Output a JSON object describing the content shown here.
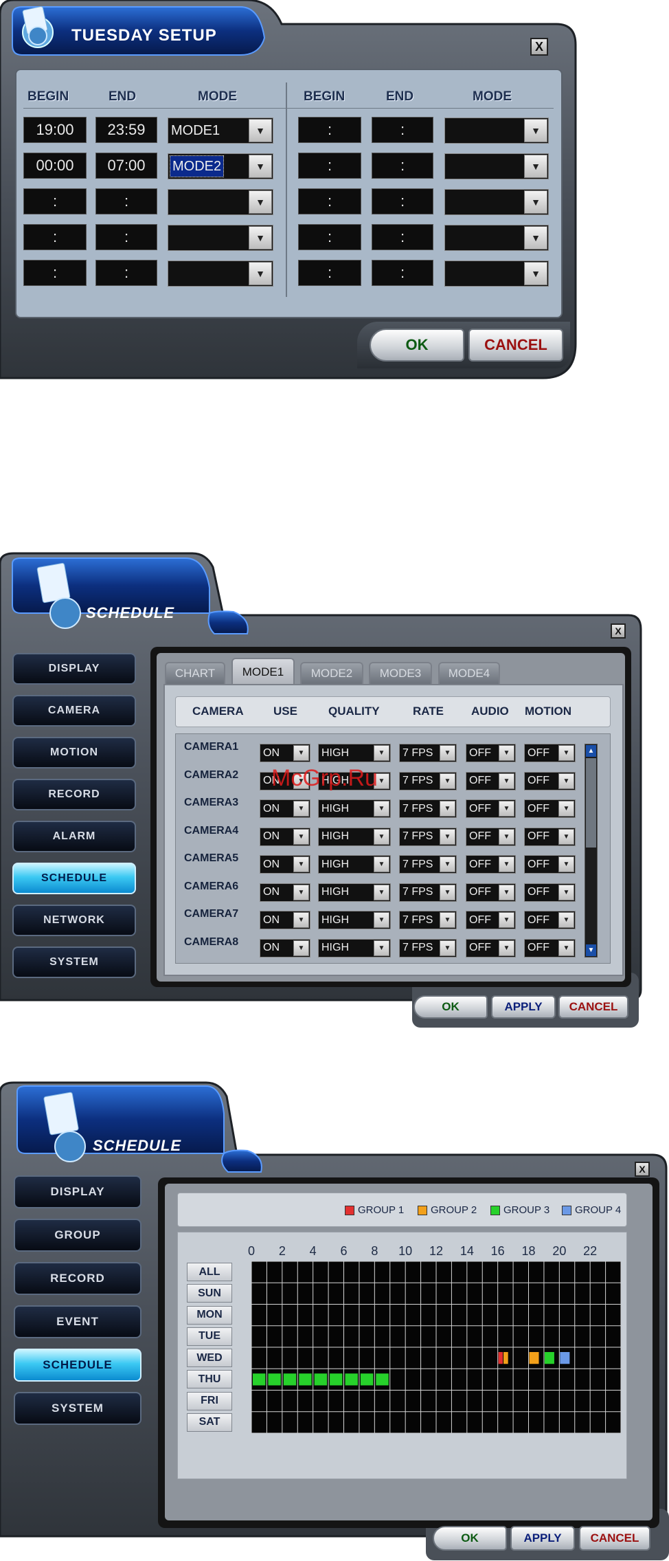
{
  "colors": {
    "panel_bg": "#a9b8c8",
    "frame_dark": "#3a4048",
    "ok_text": "#0c5a12",
    "apply_text": "#0b1f7a",
    "cancel_text": "#9b1010",
    "group1": "#e23030",
    "group2": "#f2a01a",
    "group3": "#27d12b",
    "group4": "#6b99e6"
  },
  "tuesday": {
    "title": "TUESDAY SETUP",
    "close": "X",
    "headers": {
      "begin": "BEGIN",
      "end": "END",
      "mode": "MODE"
    },
    "left_rows": [
      {
        "begin": "19:00",
        "end": "23:59",
        "mode": "MODE1"
      },
      {
        "begin": "00:00",
        "end": "07:00",
        "mode": "MODE2"
      },
      {
        "begin": ":",
        "end": ":",
        "mode": ""
      },
      {
        "begin": ":",
        "end": ":",
        "mode": ""
      },
      {
        "begin": ":",
        "end": ":",
        "mode": ""
      }
    ],
    "right_rows": [
      {
        "begin": ":",
        "end": ":",
        "mode": ""
      },
      {
        "begin": ":",
        "end": ":",
        "mode": ""
      },
      {
        "begin": ":",
        "end": ":",
        "mode": ""
      },
      {
        "begin": ":",
        "end": ":",
        "mode": ""
      },
      {
        "begin": ":",
        "end": ":",
        "mode": ""
      }
    ],
    "ok": "OK",
    "cancel": "CANCEL"
  },
  "schedule1": {
    "title": "SCHEDULE",
    "close": "X",
    "nav": [
      "DISPLAY",
      "CAMERA",
      "MOTION",
      "RECORD",
      "ALARM",
      "SCHEDULE",
      "NETWORK",
      "SYSTEM"
    ],
    "active_nav": "SCHEDULE",
    "tabs": [
      "CHART",
      "MODE1",
      "MODE2",
      "MODE3",
      "MODE4"
    ],
    "active_tab": "MODE1",
    "columns": [
      "CAMERA",
      "USE",
      "QUALITY",
      "RATE",
      "AUDIO",
      "MOTION"
    ],
    "rows": [
      {
        "camera": "CAMERA1",
        "use": "ON",
        "quality": "HIGH",
        "rate": "7 FPS",
        "audio": "OFF",
        "motion": "OFF"
      },
      {
        "camera": "CAMERA2",
        "use": "ON",
        "quality": "HIGH",
        "rate": "7 FPS",
        "audio": "OFF",
        "motion": "OFF"
      },
      {
        "camera": "CAMERA3",
        "use": "ON",
        "quality": "HIGH",
        "rate": "7 FPS",
        "audio": "OFF",
        "motion": "OFF"
      },
      {
        "camera": "CAMERA4",
        "use": "ON",
        "quality": "HIGH",
        "rate": "7 FPS",
        "audio": "OFF",
        "motion": "OFF"
      },
      {
        "camera": "CAMERA5",
        "use": "ON",
        "quality": "HIGH",
        "rate": "7 FPS",
        "audio": "OFF",
        "motion": "OFF"
      },
      {
        "camera": "CAMERA6",
        "use": "ON",
        "quality": "HIGH",
        "rate": "7 FPS",
        "audio": "OFF",
        "motion": "OFF"
      },
      {
        "camera": "CAMERA7",
        "use": "ON",
        "quality": "HIGH",
        "rate": "7 FPS",
        "audio": "OFF",
        "motion": "OFF"
      },
      {
        "camera": "CAMERA8",
        "use": "ON",
        "quality": "HIGH",
        "rate": "7 FPS",
        "audio": "OFF",
        "motion": "OFF"
      }
    ],
    "watermark": "McGrp.Ru",
    "ok": "OK",
    "apply": "APPLY",
    "cancel": "CANCEL"
  },
  "schedule2": {
    "title": "SCHEDULE",
    "close": "X",
    "nav": [
      "DISPLAY",
      "GROUP",
      "RECORD",
      "EVENT",
      "SCHEDULE",
      "SYSTEM"
    ],
    "active_nav": "SCHEDULE",
    "legend": [
      {
        "label": "GROUP 1",
        "color": "#e23030"
      },
      {
        "label": "GROUP 2",
        "color": "#f2a01a"
      },
      {
        "label": "GROUP 3",
        "color": "#27d12b"
      },
      {
        "label": "GROUP 4",
        "color": "#6b99e6"
      }
    ],
    "hour_labels": [
      "0",
      "2",
      "4",
      "6",
      "8",
      "10",
      "12",
      "14",
      "16",
      "18",
      "20",
      "22"
    ],
    "days": [
      "ALL",
      "SUN",
      "MON",
      "TUE",
      "WED",
      "THU",
      "FRI",
      "SAT"
    ],
    "blocks": [
      {
        "day": "WED",
        "start": 16.0,
        "end": 16.33,
        "group": 1
      },
      {
        "day": "WED",
        "start": 16.33,
        "end": 16.67,
        "group": 2
      },
      {
        "day": "WED",
        "start": 18.0,
        "end": 18.67,
        "group": 2
      },
      {
        "day": "WED",
        "start": 19.0,
        "end": 19.67,
        "group": 3
      },
      {
        "day": "WED",
        "start": 20.0,
        "end": 20.67,
        "group": 4
      },
      {
        "day": "THU",
        "start": 0.0,
        "end": 9.0,
        "group": 3
      }
    ],
    "ok": "OK",
    "apply": "APPLY",
    "cancel": "CANCEL"
  }
}
